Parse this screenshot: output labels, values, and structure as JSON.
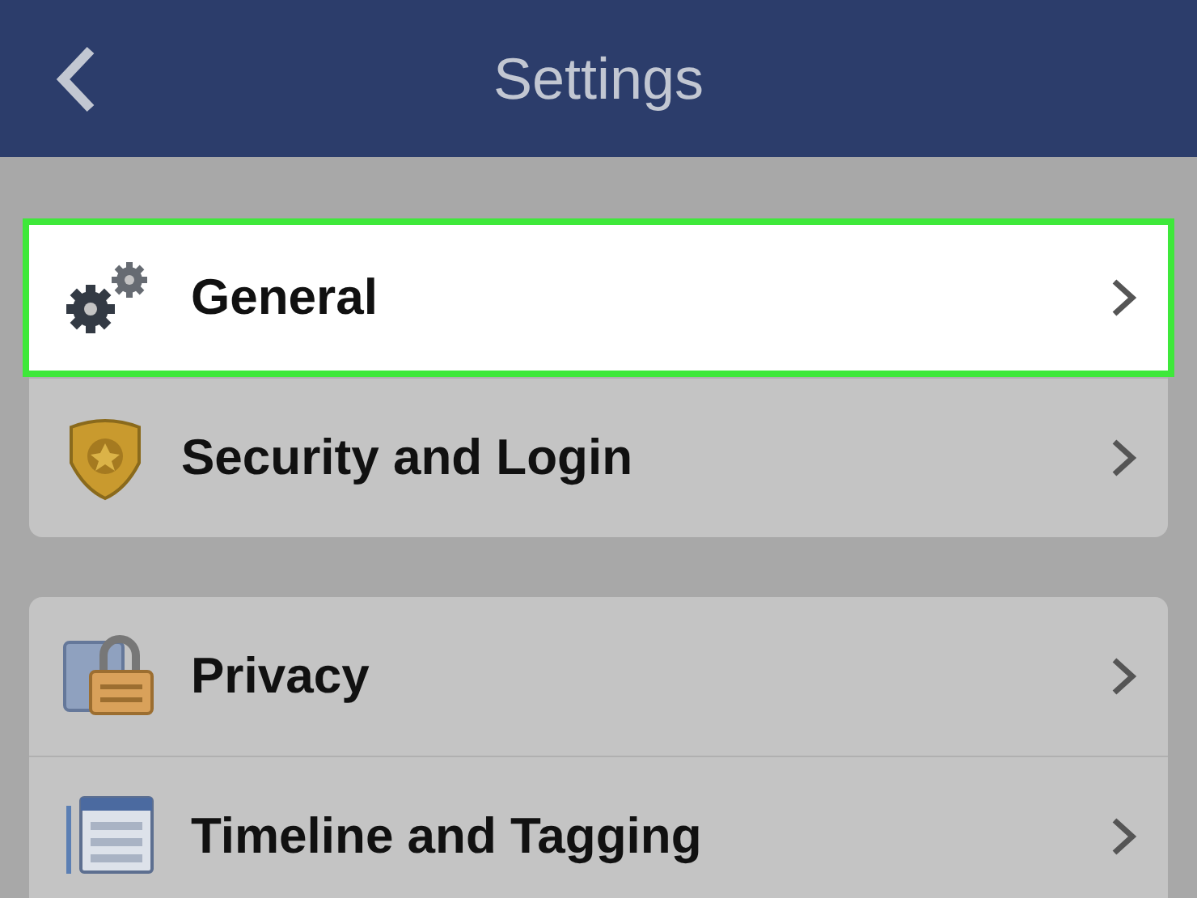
{
  "header": {
    "title": "Settings"
  },
  "groups": [
    {
      "items": [
        {
          "label": "General",
          "kind": "gears",
          "highlighted": true
        },
        {
          "label": "Security and Login",
          "kind": "badge",
          "highlighted": false
        }
      ]
    },
    {
      "items": [
        {
          "label": "Privacy",
          "kind": "lock",
          "highlighted": false
        },
        {
          "label": "Timeline and Tagging",
          "kind": "timeline",
          "highlighted": false
        }
      ]
    }
  ]
}
